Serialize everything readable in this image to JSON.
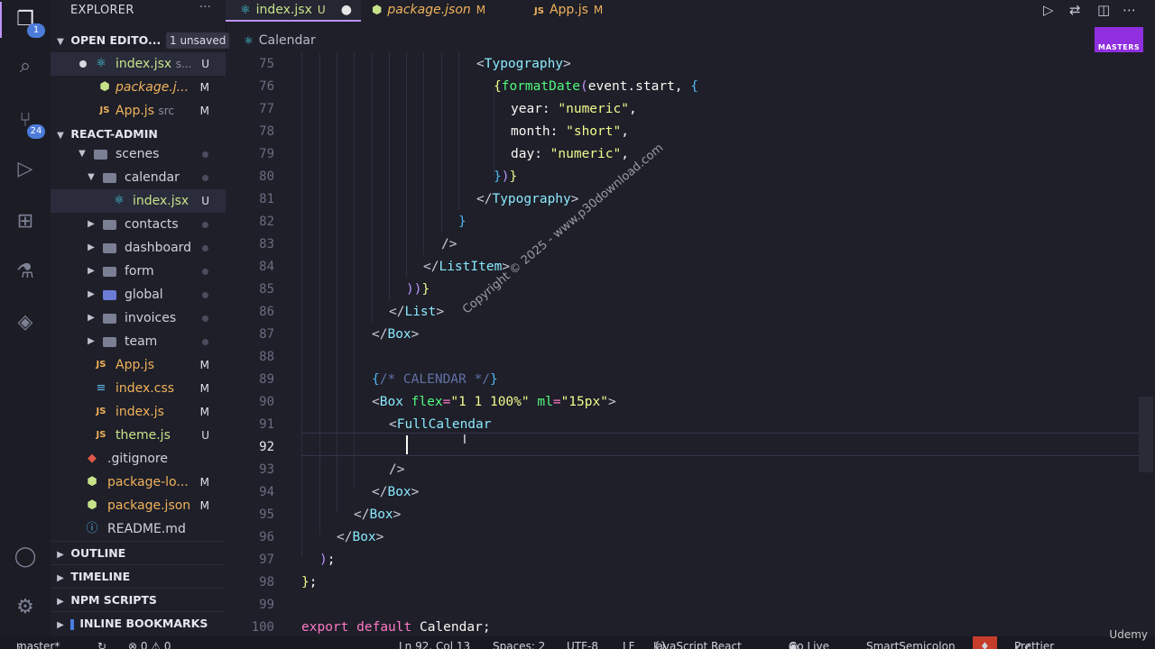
{
  "activity_bar": {
    "scm_badge": "24",
    "explorer_badge": "1"
  },
  "explorer": {
    "title": "EXPLORER",
    "more": "···",
    "open_editors": {
      "title": "OPEN EDITO...",
      "badge": "1 unsaved",
      "items": [
        {
          "name": "index.jsx",
          "path": "s...",
          "status": "U"
        },
        {
          "name": "package.j...",
          "path": "",
          "status": "M"
        },
        {
          "name": "App.js",
          "path": "src",
          "status": "M"
        }
      ]
    },
    "project": {
      "title": "REACT-ADMIN",
      "tree": {
        "scenes": "scenes",
        "calendar": "calendar",
        "calendar_index": "index.jsx",
        "calendar_index_status": "U",
        "contacts": "contacts",
        "dashboard": "dashboard",
        "form": "form",
        "global": "global",
        "invoices": "invoices",
        "team": "team",
        "app_js": "App.js",
        "app_js_status": "M",
        "index_css": "index.css",
        "index_css_status": "M",
        "index_js": "index.js",
        "index_js_status": "M",
        "theme_js": "theme.js",
        "theme_js_status": "U",
        "gitignore": ".gitignore",
        "package_lock": "package-lo...",
        "package_lock_status": "M",
        "package_json": "package.json",
        "package_json_status": "M",
        "readme": "README.md"
      }
    },
    "outline": "OUTLINE",
    "timeline": "TIMELINE",
    "npm_scripts": "NPM SCRIPTS",
    "inline_bookmarks": "INLINE BOOKMARKS"
  },
  "tabs": [
    {
      "name": "index.jsx",
      "status": "U"
    },
    {
      "name": "package.json",
      "status": "M"
    },
    {
      "name": "App.js",
      "status": "M"
    }
  ],
  "breadcrumb": "Calendar",
  "masters_logo": "MASTERS",
  "line_numbers": [
    "75",
    "76",
    "77",
    "78",
    "79",
    "80",
    "81",
    "82",
    "83",
    "84",
    "85",
    "86",
    "87",
    "88",
    "89",
    "90",
    "91",
    "92",
    "93",
    "94",
    "95",
    "96",
    "97",
    "98",
    "99",
    "100"
  ],
  "code": {
    "l75_tag": "Typography",
    "l76_fn": "formatDate",
    "l76_arg": "event.start, ",
    "l77_key": "year: ",
    "l77_val": "\"numeric\"",
    "l78_key": "month: ",
    "l78_val": "\"short\"",
    "l79_key": "day: ",
    "l79_val": "\"numeric\"",
    "l81_tag": "Typography",
    "l84_tag": "ListItem",
    "l86_tag": "List",
    "l87_tag": "Box",
    "l89_comment": "/* CALENDAR */",
    "l90_tag": "Box",
    "l90_attr1": "flex",
    "l90_val1": "\"1 1 100%\"",
    "l90_attr2": "ml",
    "l90_val2": "\"15px\"",
    "l91_tag": "FullCalendar",
    "l94_tag": "Box",
    "l95_tag": "Box",
    "l96_tag": "Box",
    "l100_kw1": "export",
    "l100_kw2": "default",
    "l100_name": "Calendar"
  },
  "watermark": "Copyright © 2025 - www.p30download.com",
  "status_bar": {
    "branch": "master*",
    "errors": "⊗ 0 ⚠ 0",
    "position": "Ln 92, Col 13",
    "spaces": "Spaces: 2",
    "encoding": "UTF-8",
    "eol": "LF",
    "language": "JavaScript React",
    "go_live": "Go Live",
    "smart_semicolon": "SmartSemicolon",
    "prettier": "Prettier"
  },
  "udemy_logo": "Udemy"
}
